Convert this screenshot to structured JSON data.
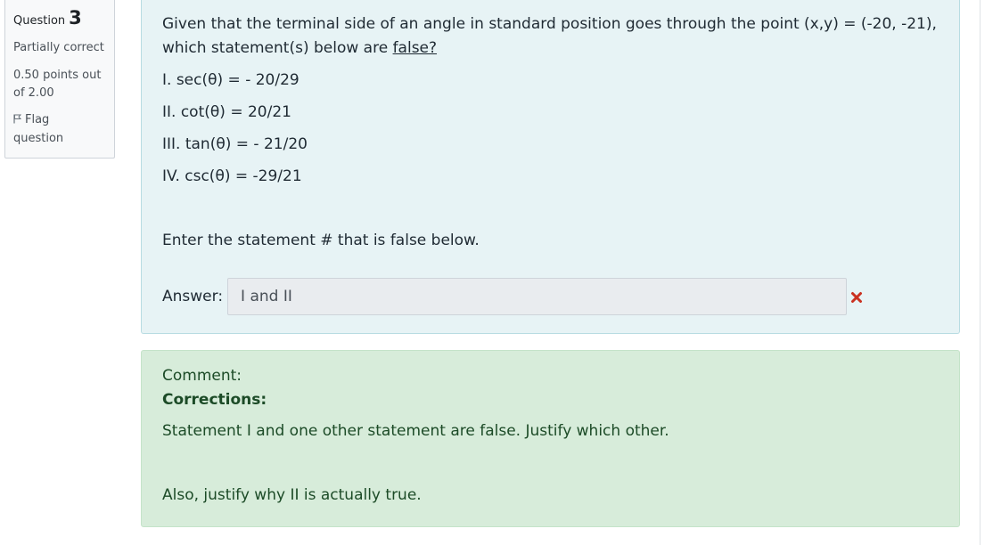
{
  "info": {
    "question_label": "Question",
    "question_number": "3",
    "state": "Partially correct",
    "grade_line1": "0.50 points out",
    "grade_line2": "of 2.00",
    "flag_line1": "Flag",
    "flag_line2": "question"
  },
  "question": {
    "text_part1": "Given that the terminal side of an angle in standard position goes through the point (x,y) = (-20, -21), which statement(s) below are ",
    "text_underlined": "false?",
    "statements": [
      "I. sec(θ) = - 20/29",
      "II. cot(θ) = 20/21",
      "III. tan(θ) = - 21/20",
      "IV. csc(θ) = -29/21"
    ],
    "instruction": "Enter the statement # that is false below.",
    "answer_label": "Answer:",
    "answer_value": "I and II",
    "result_icon": "incorrect-x-icon",
    "result_color": "#ca3120"
  },
  "feedback": {
    "comment_label": "Comment:",
    "corrections_label": "Corrections:",
    "line1": "Statement I and one other statement are false. Justify which other.",
    "line2": "Also, justify why II is actually true."
  },
  "colors": {
    "question_bg": "#e7f3f5",
    "feedback_bg": "#d7ecda",
    "info_bg": "#f8f9fa"
  }
}
